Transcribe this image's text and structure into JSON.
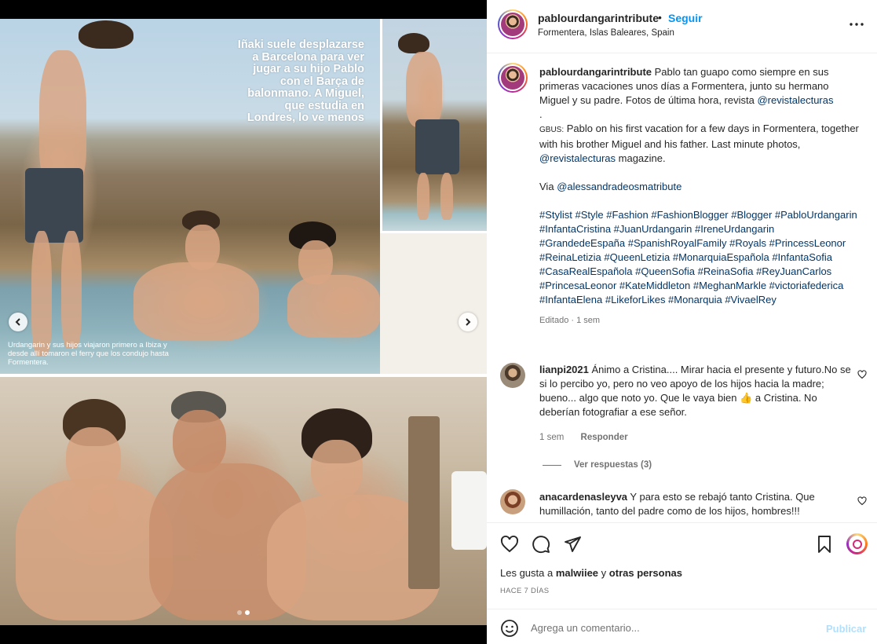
{
  "header": {
    "username": "pablourdangarintribute",
    "separator": "•",
    "follow_label": "Seguir",
    "location": "Formentera, Islas Baleares, Spain",
    "more_icon": "more-horizontal-icon"
  },
  "media": {
    "article_text": "Iñaki suele desplazarse a Barcelona para ver jugar a su hijo Pablo con el Barça de balonmano. A Miguel, que estudia en Londres, lo ve menos",
    "photo_caption": "Urdangarin y sus hijos viajaron primero a Ibiza y desde allí tomaron el ferry que los condujo hasta Formentera.",
    "carousel_slides": 2,
    "active_slide": 2
  },
  "caption": {
    "username": "pablourdangarintribute",
    "text_before_link": "Pablo tan guapo como siempre en sus primeras vacaciones unos días a Formentera, junto su hermano Miguel y su padre. Fotos de última hora, revista",
    "magazine_mention": "@revistalecturas",
    "dot_line": ".",
    "gbus_tag": "GBUS:",
    "english_before_link": "Pablo on his first vacation for a few days in Formentera, together with his brother Miguel and his father. Last minute photos,",
    "english_mention": "@revistalecturas",
    "english_after_link": "magazine.",
    "via_label": "Via",
    "via_mention": "@alessandradeosmatribute",
    "hashtags": "#Stylist #Style #Fashion #FashionBlogger #Blogger #PabloUrdangarin #InfantaCristina #JuanUrdangarin #IreneUrdangarin #GrandedeEspaña #SpanishRoyalFamily #Royals #PrincessLeonor #ReinaLetizia #QueenLetizia #MonarquiaEspañola #InfantaSofia #CasaRealEspañola #QueenSofia #ReinaSofia #ReyJuanCarlos #PrincesaLeonor #KateMiddleton #MeghanMarkle #victoriafederica #InfantaElena #LikeforLikes #Monarquia #VivaelRey",
    "edited_meta": "Editado · 1 sem"
  },
  "comments": [
    {
      "username": "lianpi2021",
      "text": "Ánimo a Cristina.... Mirar hacia el presente y futuro.No se si lo percibo yo, pero no veo apoyo de los hijos hacia la madre; bueno... algo que noto yo. Que le vaya bien 👍 a Cristina. No deberían fotografiar a ese señor.",
      "time": "1 sem",
      "reply_label": "Responder",
      "view_replies": "Ver respuestas (3)"
    },
    {
      "username": "anacardenasleyva",
      "text": "Y para esto se rebajó tanto Cristina. Que humillación, tanto del padre como de los hijos, hombres!!!"
    }
  ],
  "actions": {
    "likes_prefix": "Les gusta a",
    "likes_user": "malwiiee",
    "likes_connector": "y",
    "likes_others": "otras personas",
    "date": "HACE 7 DÍAS"
  },
  "add_comment": {
    "placeholder": "Agrega un comentario...",
    "publish_label": "Publicar"
  },
  "colors": {
    "accent": "#0095f6",
    "link": "#00376b",
    "muted": "#737373",
    "publish_disabled": "#b2dffc"
  }
}
